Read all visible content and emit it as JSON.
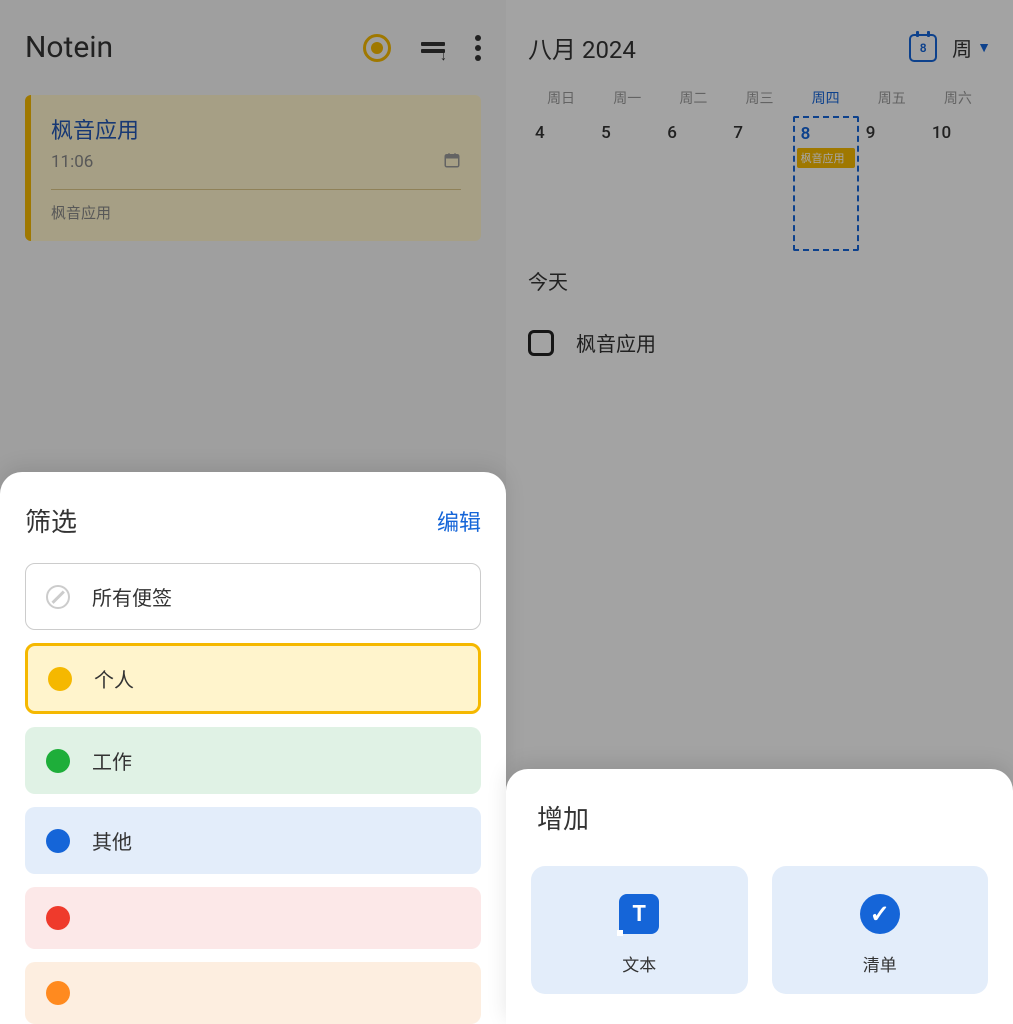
{
  "left": {
    "app_name": "Notein",
    "note": {
      "title": "枫音应用",
      "time": "11:06",
      "body": "枫音应用"
    }
  },
  "right": {
    "month": "八月 2024",
    "today_date": "8",
    "view_label": "周",
    "weekdays": [
      "周日",
      "周一",
      "周二",
      "周三",
      "周四",
      "周五",
      "周六"
    ],
    "days": [
      "4",
      "5",
      "6",
      "7",
      "8",
      "9",
      "10"
    ],
    "event_pill": "枫音应用",
    "today_label": "今天",
    "task": "枫音应用"
  },
  "filter": {
    "title": "筛选",
    "edit": "编辑",
    "items": {
      "all": "所有便签",
      "personal": "个人",
      "work": "工作",
      "other": "其他"
    },
    "colors": {
      "personal": "#f5b800",
      "work": "#1eae3a",
      "other": "#1565d8",
      "red": "#ef3a2c",
      "orange": "#ff8a1f"
    }
  },
  "add": {
    "title": "增加",
    "text_btn": "文本",
    "list_btn": "清单"
  }
}
